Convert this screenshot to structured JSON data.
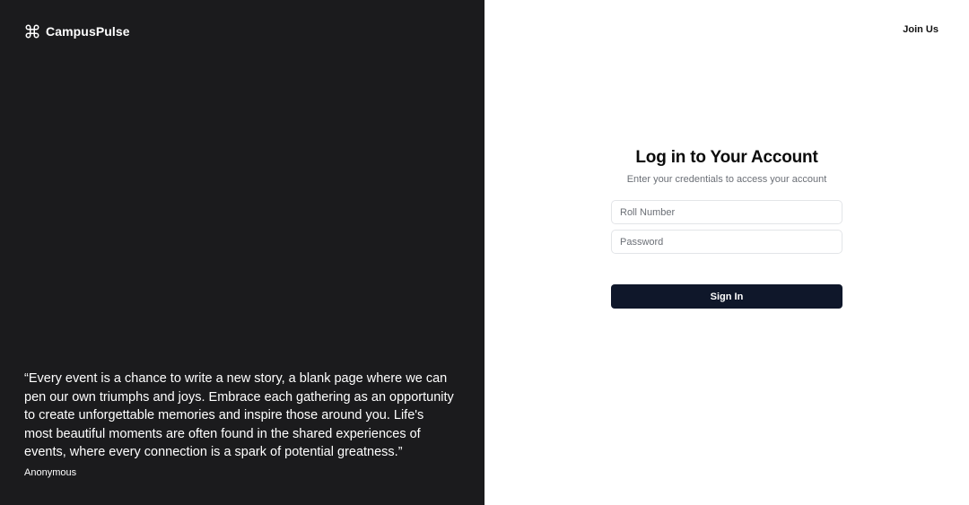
{
  "brand": {
    "name": "CampusPulse",
    "icon": "command-icon"
  },
  "header": {
    "join_label": "Join Us"
  },
  "testimonial": {
    "quote": "“Every event is a chance to write a new story, a blank page where we can pen our own triumphs and joys. Embrace each gathering as an opportunity to create unforgettable memories and inspire those around you. Life's most beautiful moments are often found in the shared experiences of events, where every connection is a spark of potential greatness.”",
    "author": "Anonymous"
  },
  "login": {
    "title": "Log in to Your Account",
    "subtitle": "Enter your credentials to access your account",
    "roll_number": {
      "placeholder": "Roll Number",
      "value": ""
    },
    "password": {
      "placeholder": "Password",
      "value": ""
    },
    "submit_label": "Sign In"
  },
  "colors": {
    "left_panel": "#1b1b1d",
    "button": "#0f172a",
    "muted_text": "#6b6f76"
  }
}
